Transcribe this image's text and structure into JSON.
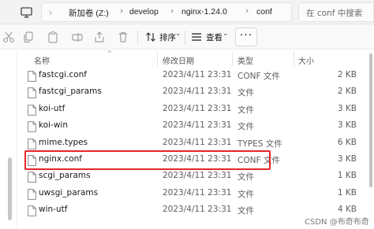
{
  "address": {
    "back_glyph": "›",
    "path": [
      "新加卷 (Z:)",
      "develop",
      "nginx-1.24.0",
      "conf"
    ],
    "separator": "›",
    "search_placeholder": "在 conf 中搜索"
  },
  "toolbar": {
    "sort_label": "排序",
    "view_label": "查看",
    "more_label": "···",
    "caret": "⌄"
  },
  "columns": {
    "name": "名称",
    "date": "修改日期",
    "type": "类型",
    "size": "大小"
  },
  "files": [
    {
      "name": "fastcgi.conf",
      "date": "2023/4/11 23:31",
      "type": "CONF 文件",
      "size": "2 KB"
    },
    {
      "name": "fastcgi_params",
      "date": "2023/4/11 23:31",
      "type": "文件",
      "size": "2 KB"
    },
    {
      "name": "koi-utf",
      "date": "2023/4/11 23:31",
      "type": "文件",
      "size": "3 KB"
    },
    {
      "name": "koi-win",
      "date": "2023/4/11 23:31",
      "type": "文件",
      "size": "3 KB"
    },
    {
      "name": "mime.types",
      "date": "2023/4/11 23:31",
      "type": "TYPES 文件",
      "size": "6 KB"
    },
    {
      "name": "nginx.conf",
      "date": "2023/4/11 23:31",
      "type": "CONF 文件",
      "size": "3 KB"
    },
    {
      "name": "scgi_params",
      "date": "2023/4/11 23:31",
      "type": "文件",
      "size": "1 KB"
    },
    {
      "name": "uwsgi_params",
      "date": "2023/4/11 23:31",
      "type": "文件",
      "size": "1 KB"
    },
    {
      "name": "win-utf",
      "date": "2023/4/11 23:31",
      "type": "文件",
      "size": "4 KB"
    }
  ],
  "highlighted_file": "nginx.conf",
  "highlight_color": "#e3262b",
  "watermark": "CSDN @布奇布奇"
}
